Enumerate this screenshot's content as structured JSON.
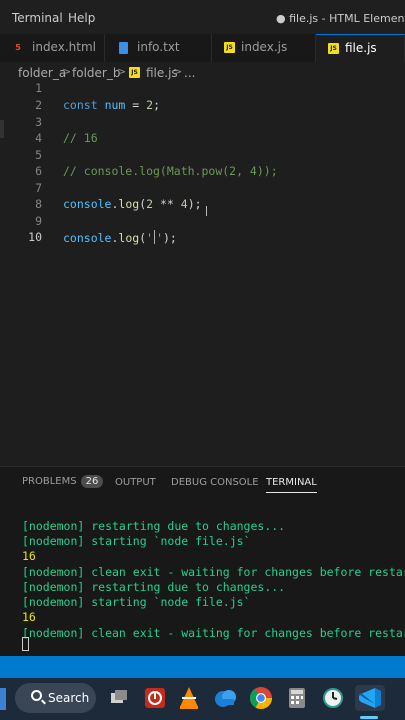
{
  "menu": {
    "terminal": "Terminal",
    "help": "Help"
  },
  "window_title": "● file.js - HTML Elements - V",
  "tabs": [
    {
      "label": "index.html",
      "icon": "html5-icon",
      "icon_text": "5"
    },
    {
      "label": "info.txt",
      "icon": "text-file-icon",
      "icon_text": ""
    },
    {
      "label": "index.js",
      "icon": "js-file-icon",
      "icon_text": "JS"
    },
    {
      "label": "file.js",
      "icon": "js-file-icon",
      "icon_text": "JS"
    }
  ],
  "breadcrumb": {
    "folder_a": "folder_a",
    "folder_b": "folder_b",
    "file": "file.js",
    "ellipsis": "...",
    "sep": ">"
  },
  "editor": {
    "line_numbers": [
      "1",
      "2",
      "3",
      "4",
      "5",
      "6",
      "7",
      "8",
      "9",
      "10"
    ],
    "line2": {
      "kw": "const",
      "name": "num",
      "rest": " = ",
      "num": "2",
      "end": ";"
    },
    "line4": "// 16",
    "line6": "// console.log(Math.pow(2, 4));",
    "line8": {
      "obj": "console",
      "dot": ".",
      "fn": "log",
      "open": "(",
      "a": "2",
      "op": " ** ",
      "b": "4",
      "close": ");"
    },
    "line10": {
      "obj": "console",
      "dot": ".",
      "fn": "log",
      "open": "(",
      "q1": "'",
      "q2": "'",
      "close": ");"
    }
  },
  "panel": {
    "problems": "PROBLEMS",
    "problems_count": "26",
    "output": "OUTPUT",
    "debug_console": "DEBUG CONSOLE",
    "terminal": "TERMINAL",
    "lines": [
      "[nodemon] restarting due to changes...",
      "[nodemon] starting `node file.js`",
      "16",
      "[nodemon] clean exit - waiting for changes before restart",
      "[nodemon] restarting due to changes...",
      "[nodemon] starting `node file.js`",
      "16",
      "[nodemon] clean exit - waiting for changes before restart"
    ]
  },
  "taskbar": {
    "search": "Search"
  },
  "colors": {
    "accent": "#007acc",
    "terminal_green": "#23d18b",
    "terminal_yellow": "#e5e510",
    "keyword": "#569cd6",
    "comment": "#6a9955"
  }
}
